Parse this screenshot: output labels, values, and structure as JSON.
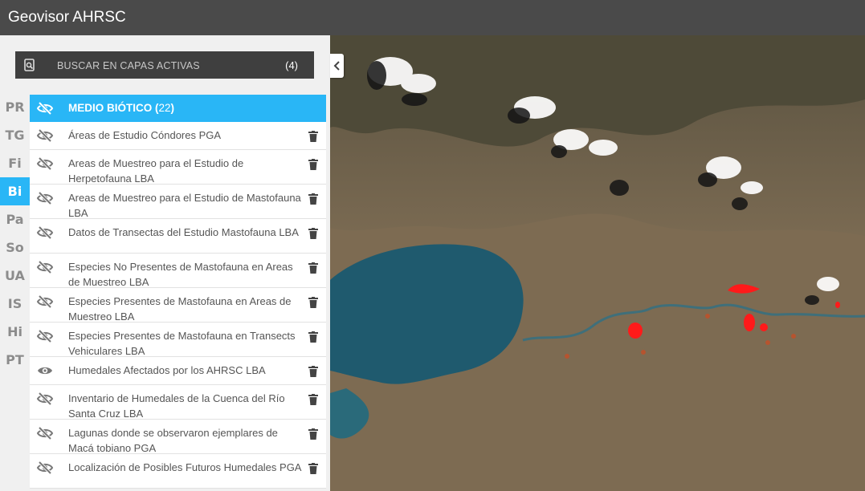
{
  "app": {
    "title": "Geovisor AHRSC"
  },
  "search": {
    "label": "BUSCAR EN CAPAS ACTIVAS",
    "count": "(4)"
  },
  "tabs": [
    "PR",
    "TG",
    "Fi",
    "Bi",
    "Pa",
    "So",
    "UA",
    "IS",
    "Hi",
    "PT"
  ],
  "active_tab": "Bi",
  "group": {
    "label": "MEDIO BIÓTICO (",
    "count": "22",
    "close": ")"
  },
  "layers": [
    {
      "label": "Áreas de Estudio Cóndores PGA",
      "visible": false
    },
    {
      "label": "Areas de Muestreo para el Estudio de Herpetofauna LBA",
      "visible": false
    },
    {
      "label": "Areas de Muestreo para el Estudio de Mastofauna LBA",
      "visible": false
    },
    {
      "label": "Datos de Transectas del Estudio Mastofauna LBA",
      "visible": false
    },
    {
      "label": "Especies No Presentes de Mastofauna en Areas de Muestreo LBA",
      "visible": false
    },
    {
      "label": "Especies Presentes de Mastofauna en Areas de Muestreo LBA",
      "visible": false
    },
    {
      "label": "Especies Presentes de Mastofauna en Transects Vehiculares LBA",
      "visible": false
    },
    {
      "label": "Humedales Afectados por los AHRSC LBA",
      "visible": true
    },
    {
      "label": "Inventario de Humedales de la Cuenca del Río Santa Cruz LBA",
      "visible": false
    },
    {
      "label": "Lagunas donde se observaron ejemplares de Macá tobiano PGA",
      "visible": false
    },
    {
      "label": "Localización de Posibles Futuros Humedales PGA",
      "visible": false
    }
  ],
  "icons": {
    "eye_hidden": "eye-slash-icon",
    "eye_visible": "eye-icon",
    "delete": "trash-icon",
    "search": "layers-search-icon",
    "collapse": "chevron-left-icon"
  },
  "colors": {
    "accent": "#29b6f6",
    "topbar": "#4a4a4a",
    "search_bg": "#3f3f3f",
    "highlight": "#ff1a1a"
  }
}
